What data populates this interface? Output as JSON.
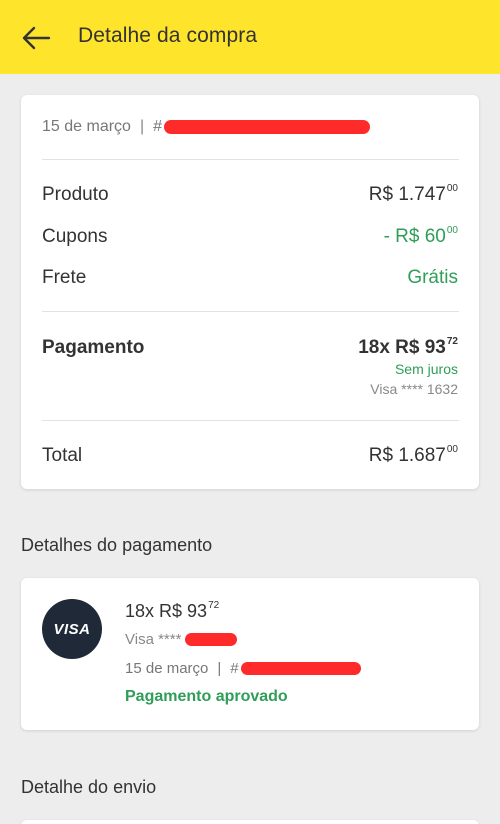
{
  "appbar": {
    "title": "Detalhe da compra",
    "back_icon": "arrow-left-icon"
  },
  "summary": {
    "date": "15 de março",
    "separator": "|",
    "order_prefix": "#",
    "rows": {
      "produto": {
        "label": "Produto",
        "value": "R$ 1.747",
        "cents": "00"
      },
      "cupons": {
        "label": "Cupons",
        "value": "- R$ 60",
        "cents": "00"
      },
      "frete": {
        "label": "Frete",
        "value": "Grátis"
      }
    },
    "pagamento": {
      "label": "Pagamento",
      "value": "18x R$ 93",
      "cents": "72",
      "interest": "Sem juros",
      "card": "Visa **** 1632"
    },
    "total": {
      "label": "Total",
      "value": "R$ 1.687",
      "cents": "00"
    }
  },
  "payment_details": {
    "section_title": "Detalhes do pagamento",
    "brand": "VISA",
    "amount": "18x R$ 93",
    "cents": "72",
    "card_prefix": "Visa ****",
    "date": "15 de março",
    "separator": "|",
    "order_prefix": "#",
    "status": "Pagamento aprovado"
  },
  "shipping": {
    "section_title": "Detalhe do envio"
  },
  "colors": {
    "appbar": "#ffe42c",
    "green": "#2e9e58",
    "redaction": "#ff2a2a",
    "visa_badge": "#1f2937"
  }
}
